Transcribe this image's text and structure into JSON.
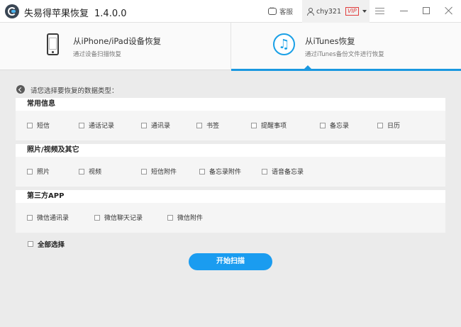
{
  "titlebar": {
    "app_name": "失易得苹果恢复",
    "version": "1.4.0.0",
    "feedback_label": "客服",
    "username": "chy321",
    "vip_badge": "VIP"
  },
  "modes": {
    "device": {
      "title": "从iPhone/iPad设备恢复",
      "subtitle": "通过设备扫描恢复"
    },
    "itunes": {
      "title": "从iTunes恢复",
      "subtitle": "通过iTunes备份文件进行恢复",
      "selected": true
    }
  },
  "prompt": "请您选择要恢复的数据类型：",
  "groups": [
    {
      "title": "常用信息",
      "items": [
        "短信",
        "通话记录",
        "通讯录",
        "书签",
        "提醒事项",
        "备忘录",
        "日历"
      ]
    },
    {
      "title": "照片/视频及其它",
      "items": [
        "照片",
        "视频",
        "短信附件",
        "备忘录附件",
        "语音备忘录"
      ]
    },
    {
      "title": "第三方APP",
      "items": [
        "微信通讯录",
        "微信聊天记录",
        "微信附件"
      ]
    }
  ],
  "select_all_label": "全部选择",
  "scan_button_label": "开始扫描",
  "colors": {
    "accent": "#1a9cf0",
    "vip": "#e13c3c"
  }
}
